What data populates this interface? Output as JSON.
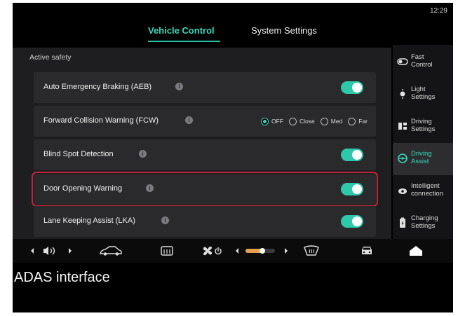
{
  "status": {
    "clock": "12:29"
  },
  "tabs": [
    {
      "label": "Vehicle Control",
      "active": true
    },
    {
      "label": "System Settings",
      "active": false
    }
  ],
  "section_title": "Active safety",
  "rows": [
    {
      "label": "Auto Emergency Braking (AEB)",
      "control": "toggle",
      "on": true
    },
    {
      "label": "Forward Collision Warning (FCW)",
      "control": "radio",
      "options": [
        "OFF",
        "Close",
        "Med",
        "Far"
      ],
      "selected": "OFF"
    },
    {
      "label": "Blind Spot Detection",
      "control": "toggle",
      "on": true
    },
    {
      "label": "Door Opening Warning",
      "control": "toggle",
      "on": true,
      "highlighted": true
    },
    {
      "label": "Lane Keeping Assist (LKA)",
      "control": "toggle",
      "on": true
    }
  ],
  "sidebar": {
    "items": [
      {
        "label": "Fast\nControl",
        "icon": "fast-control-icon",
        "active": false
      },
      {
        "label": "Light\nSettings",
        "icon": "light-icon",
        "active": false
      },
      {
        "label": "Driving\nSettings",
        "icon": "driving-settings-icon",
        "active": false
      },
      {
        "label": "Driving\nAssist",
        "icon": "steering-wheel-icon",
        "active": true
      },
      {
        "label": "Intelligent\nconnection",
        "icon": "connection-icon",
        "active": false
      },
      {
        "label": "Charging\nSettings",
        "icon": "charging-icon",
        "active": false
      }
    ]
  },
  "caption": "ADAS interface",
  "colors": {
    "accent": "#39d6b8",
    "toggle_on": "#2fc7a9",
    "highlight": "#c0263a"
  }
}
